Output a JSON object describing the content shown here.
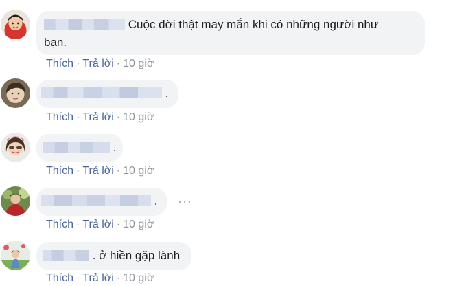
{
  "comments": [
    {
      "text": "Cuộc đời thật may mắn khi có những người như",
      "text_line2": "bạn.",
      "like_label": "Thích",
      "reply_label": "Trả lời",
      "time": "10 giờ"
    },
    {
      "text": ".",
      "like_label": "Thích",
      "reply_label": "Trả lời",
      "time": "10 giờ"
    },
    {
      "text": ".",
      "like_label": "Thích",
      "reply_label": "Trả lời",
      "time": "10 giờ"
    },
    {
      "text": ".",
      "like_label": "Thích",
      "reply_label": "Trả lời",
      "time": "10 giờ",
      "more_label": "···"
    },
    {
      "text": ". ở hiền gặp lành",
      "like_label": "Thích",
      "reply_label": "Trả lời",
      "time": "10 giờ"
    }
  ],
  "separator": "·",
  "colors": {
    "bubble": "#f2f3f5",
    "link": "#4b67a1",
    "meta": "#90949c",
    "text": "#1c1e21"
  }
}
